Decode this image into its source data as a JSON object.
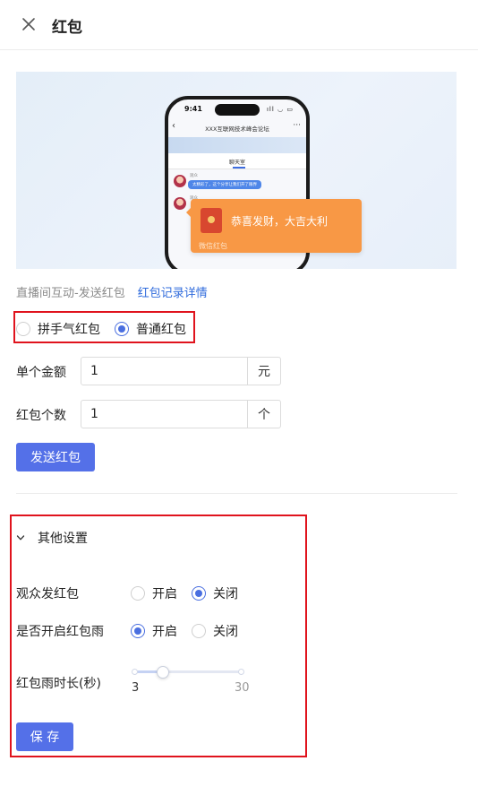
{
  "header": {
    "title": "红包",
    "close_icon": "close-icon"
  },
  "preview": {
    "phone_time": "9:41",
    "phone_status": "ıll ◡ ▭",
    "room_title": "XXX互联网技术峰会论坛",
    "chat_tab": "聊天室",
    "messages": [
      {
        "user": "观众",
        "text": "太精彩了，这个分享让我们开了眼界"
      },
      {
        "user": "观众"
      }
    ],
    "red_packet": {
      "greeting": "恭喜发财，大吉大利",
      "source": "微信红包"
    }
  },
  "links": {
    "section_label": "直播间互动-发送红包",
    "records_link": "红包记录详情"
  },
  "packet_type": {
    "options": [
      "拼手气红包",
      "普通红包"
    ],
    "selected": "普通红包"
  },
  "amount": {
    "label": "单个金额",
    "value": "1",
    "unit": "元"
  },
  "count": {
    "label": "红包个数",
    "value": "1",
    "unit": "个"
  },
  "send_button": "发送红包",
  "other_settings": {
    "title": "其他设置",
    "expanded": true,
    "audience_send": {
      "label": "观众发红包",
      "options": [
        "开启",
        "关闭"
      ],
      "selected": "关闭"
    },
    "rain_enabled": {
      "label": "是否开启红包雨",
      "options": [
        "开启",
        "关闭"
      ],
      "selected": "开启"
    },
    "rain_duration": {
      "label": "红包雨时长(秒)",
      "min": "3",
      "max": "30",
      "value": 3
    },
    "save_button": "保 存"
  },
  "colors": {
    "primary": "#5470e8",
    "highlight_border": "#e0131d",
    "link": "#2f6bdc",
    "red_packet": "#f89845"
  }
}
